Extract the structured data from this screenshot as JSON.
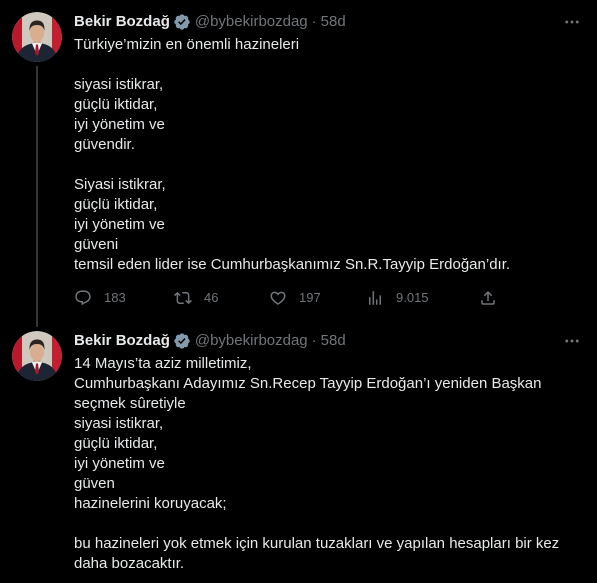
{
  "tweets": [
    {
      "author": {
        "name": "Bekir Bozdağ",
        "handle": "@bybekirbozdag",
        "separator": "·",
        "time": "58d",
        "verified_icon": "verified-badge-icon"
      },
      "paragraphs": [
        [
          "Türkiye’mizin en önemli hazineleri"
        ],
        [
          "siyasi istikrar,",
          "güçlü iktidar,",
          "iyi yönetim ve",
          "güvendir."
        ],
        [
          "Siyasi istikrar,",
          "güçlü iktidar,",
          "iyi yönetim ve",
          "güveni",
          "temsil eden lider ise Cumhurbaşkanımız Sn.R.Tayyip Erdoğan’dır."
        ]
      ],
      "actions": {
        "reply": {
          "icon": "reply-icon",
          "count": "183"
        },
        "retweet": {
          "icon": "retweet-icon",
          "count": "46"
        },
        "like": {
          "icon": "heart-icon",
          "count": "197"
        },
        "views": {
          "icon": "views-chart-icon",
          "count": "9.015"
        },
        "share": {
          "icon": "share-icon"
        }
      }
    },
    {
      "author": {
        "name": "Bekir Bozdağ",
        "handle": "@bybekirbozdag",
        "separator": "·",
        "time": "58d",
        "verified_icon": "verified-badge-icon"
      },
      "paragraphs": [
        [
          "14 Mayıs’ta aziz milletimiz,",
          "Cumhurbaşkanı Adayımız Sn.Recep Tayyip Erdoğan’ı yeniden Başkan",
          "seçmek sûretiyle",
          "siyasi istikrar,",
          "güçlü iktidar,",
          "iyi yönetim ve",
          "güven",
          "hazinelerini koruyacak;"
        ],
        [
          "bu hazineleri yok etmek için kurulan tuzakları ve yapılan hesapları bir kez",
          "daha bozacaktır."
        ]
      ]
    }
  ],
  "icons": {
    "more": "more-horizontal-icon",
    "avatar": "profile-photo"
  },
  "colors": {
    "background": "#000000",
    "text": "#e7e9ea",
    "secondary": "#71767b",
    "badge": "#829aab",
    "thread_line": "#333639"
  }
}
